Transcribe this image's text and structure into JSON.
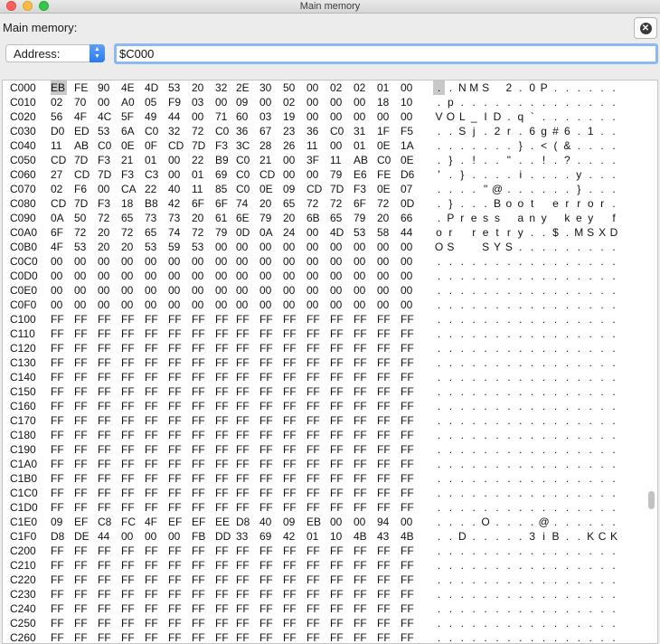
{
  "window": {
    "title": "Main memory"
  },
  "panel": {
    "label": "Main memory:"
  },
  "address_select": {
    "selected": "Address:"
  },
  "address_input": {
    "value": "$C000"
  },
  "colors": {
    "selection": "#c8c8c8",
    "focus_ring": "#8eb8f0",
    "popup_button": "#2a79f2"
  },
  "highlight": {
    "row": 0,
    "byte": 0
  },
  "rows": [
    {
      "addr": "C000",
      "bytes": [
        "EB",
        "FE",
        "90",
        "4E",
        "4D",
        "53",
        "20",
        "32",
        "2E",
        "30",
        "50",
        "00",
        "02",
        "02",
        "01",
        "00"
      ],
      "ascii": "..NMS 2.0P......"
    },
    {
      "addr": "C010",
      "bytes": [
        "02",
        "70",
        "00",
        "A0",
        "05",
        "F9",
        "03",
        "00",
        "09",
        "00",
        "02",
        "00",
        "00",
        "00",
        "18",
        "10"
      ],
      "ascii": ".p.............."
    },
    {
      "addr": "C020",
      "bytes": [
        "56",
        "4F",
        "4C",
        "5F",
        "49",
        "44",
        "00",
        "71",
        "60",
        "03",
        "19",
        "00",
        "00",
        "00",
        "00",
        "00"
      ],
      "ascii": "VOL_ID.q`......."
    },
    {
      "addr": "C030",
      "bytes": [
        "D0",
        "ED",
        "53",
        "6A",
        "C0",
        "32",
        "72",
        "C0",
        "36",
        "67",
        "23",
        "36",
        "C0",
        "31",
        "1F",
        "F5"
      ],
      "ascii": "..Sj.2r.6g#6.1.."
    },
    {
      "addr": "C040",
      "bytes": [
        "11",
        "AB",
        "C0",
        "0E",
        "0F",
        "CD",
        "7D",
        "F3",
        "3C",
        "28",
        "26",
        "11",
        "00",
        "01",
        "0E",
        "1A"
      ],
      "ascii": ".......}.<(&...."
    },
    {
      "addr": "C050",
      "bytes": [
        "CD",
        "7D",
        "F3",
        "21",
        "01",
        "00",
        "22",
        "B9",
        "C0",
        "21",
        "00",
        "3F",
        "11",
        "AB",
        "C0",
        "0E"
      ],
      "ascii": ".}.!..\"..!.?...."
    },
    {
      "addr": "C060",
      "bytes": [
        "27",
        "CD",
        "7D",
        "F3",
        "C3",
        "00",
        "01",
        "69",
        "C0",
        "CD",
        "00",
        "00",
        "79",
        "E6",
        "FE",
        "D6"
      ],
      "ascii": "'.}....i....y..."
    },
    {
      "addr": "C070",
      "bytes": [
        "02",
        "F6",
        "00",
        "CA",
        "22",
        "40",
        "11",
        "85",
        "C0",
        "0E",
        "09",
        "CD",
        "7D",
        "F3",
        "0E",
        "07"
      ],
      "ascii": "....\"@......}..."
    },
    {
      "addr": "C080",
      "bytes": [
        "CD",
        "7D",
        "F3",
        "18",
        "B8",
        "42",
        "6F",
        "6F",
        "74",
        "20",
        "65",
        "72",
        "72",
        "6F",
        "72",
        "0D"
      ],
      "ascii": ".}...Boot error."
    },
    {
      "addr": "C090",
      "bytes": [
        "0A",
        "50",
        "72",
        "65",
        "73",
        "73",
        "20",
        "61",
        "6E",
        "79",
        "20",
        "6B",
        "65",
        "79",
        "20",
        "66"
      ],
      "ascii": ".Press any key f"
    },
    {
      "addr": "C0A0",
      "bytes": [
        "6F",
        "72",
        "20",
        "72",
        "65",
        "74",
        "72",
        "79",
        "0D",
        "0A",
        "24",
        "00",
        "4D",
        "53",
        "58",
        "44"
      ],
      "ascii": "or retry..$.MSXD"
    },
    {
      "addr": "C0B0",
      "bytes": [
        "4F",
        "53",
        "20",
        "20",
        "53",
        "59",
        "53",
        "00",
        "00",
        "00",
        "00",
        "00",
        "00",
        "00",
        "00",
        "00"
      ],
      "ascii": "OS  SYS........."
    },
    {
      "addr": "C0C0",
      "bytes": [
        "00",
        "00",
        "00",
        "00",
        "00",
        "00",
        "00",
        "00",
        "00",
        "00",
        "00",
        "00",
        "00",
        "00",
        "00",
        "00"
      ],
      "ascii": "................"
    },
    {
      "addr": "C0D0",
      "bytes": [
        "00",
        "00",
        "00",
        "00",
        "00",
        "00",
        "00",
        "00",
        "00",
        "00",
        "00",
        "00",
        "00",
        "00",
        "00",
        "00"
      ],
      "ascii": "................"
    },
    {
      "addr": "C0E0",
      "bytes": [
        "00",
        "00",
        "00",
        "00",
        "00",
        "00",
        "00",
        "00",
        "00",
        "00",
        "00",
        "00",
        "00",
        "00",
        "00",
        "00"
      ],
      "ascii": "................"
    },
    {
      "addr": "C0F0",
      "bytes": [
        "00",
        "00",
        "00",
        "00",
        "00",
        "00",
        "00",
        "00",
        "00",
        "00",
        "00",
        "00",
        "00",
        "00",
        "00",
        "00"
      ],
      "ascii": "................"
    },
    {
      "addr": "C100",
      "bytes": [
        "FF",
        "FF",
        "FF",
        "FF",
        "FF",
        "FF",
        "FF",
        "FF",
        "FF",
        "FF",
        "FF",
        "FF",
        "FF",
        "FF",
        "FF",
        "FF"
      ],
      "ascii": "................"
    },
    {
      "addr": "C110",
      "bytes": [
        "FF",
        "FF",
        "FF",
        "FF",
        "FF",
        "FF",
        "FF",
        "FF",
        "FF",
        "FF",
        "FF",
        "FF",
        "FF",
        "FF",
        "FF",
        "FF"
      ],
      "ascii": "................"
    },
    {
      "addr": "C120",
      "bytes": [
        "FF",
        "FF",
        "FF",
        "FF",
        "FF",
        "FF",
        "FF",
        "FF",
        "FF",
        "FF",
        "FF",
        "FF",
        "FF",
        "FF",
        "FF",
        "FF"
      ],
      "ascii": "................"
    },
    {
      "addr": "C130",
      "bytes": [
        "FF",
        "FF",
        "FF",
        "FF",
        "FF",
        "FF",
        "FF",
        "FF",
        "FF",
        "FF",
        "FF",
        "FF",
        "FF",
        "FF",
        "FF",
        "FF"
      ],
      "ascii": "................"
    },
    {
      "addr": "C140",
      "bytes": [
        "FF",
        "FF",
        "FF",
        "FF",
        "FF",
        "FF",
        "FF",
        "FF",
        "FF",
        "FF",
        "FF",
        "FF",
        "FF",
        "FF",
        "FF",
        "FF"
      ],
      "ascii": "................"
    },
    {
      "addr": "C150",
      "bytes": [
        "FF",
        "FF",
        "FF",
        "FF",
        "FF",
        "FF",
        "FF",
        "FF",
        "FF",
        "FF",
        "FF",
        "FF",
        "FF",
        "FF",
        "FF",
        "FF"
      ],
      "ascii": "................"
    },
    {
      "addr": "C160",
      "bytes": [
        "FF",
        "FF",
        "FF",
        "FF",
        "FF",
        "FF",
        "FF",
        "FF",
        "FF",
        "FF",
        "FF",
        "FF",
        "FF",
        "FF",
        "FF",
        "FF"
      ],
      "ascii": "................"
    },
    {
      "addr": "C170",
      "bytes": [
        "FF",
        "FF",
        "FF",
        "FF",
        "FF",
        "FF",
        "FF",
        "FF",
        "FF",
        "FF",
        "FF",
        "FF",
        "FF",
        "FF",
        "FF",
        "FF"
      ],
      "ascii": "................"
    },
    {
      "addr": "C180",
      "bytes": [
        "FF",
        "FF",
        "FF",
        "FF",
        "FF",
        "FF",
        "FF",
        "FF",
        "FF",
        "FF",
        "FF",
        "FF",
        "FF",
        "FF",
        "FF",
        "FF"
      ],
      "ascii": "................"
    },
    {
      "addr": "C190",
      "bytes": [
        "FF",
        "FF",
        "FF",
        "FF",
        "FF",
        "FF",
        "FF",
        "FF",
        "FF",
        "FF",
        "FF",
        "FF",
        "FF",
        "FF",
        "FF",
        "FF"
      ],
      "ascii": "................"
    },
    {
      "addr": "C1A0",
      "bytes": [
        "FF",
        "FF",
        "FF",
        "FF",
        "FF",
        "FF",
        "FF",
        "FF",
        "FF",
        "FF",
        "FF",
        "FF",
        "FF",
        "FF",
        "FF",
        "FF"
      ],
      "ascii": "................"
    },
    {
      "addr": "C1B0",
      "bytes": [
        "FF",
        "FF",
        "FF",
        "FF",
        "FF",
        "FF",
        "FF",
        "FF",
        "FF",
        "FF",
        "FF",
        "FF",
        "FF",
        "FF",
        "FF",
        "FF"
      ],
      "ascii": "................"
    },
    {
      "addr": "C1C0",
      "bytes": [
        "FF",
        "FF",
        "FF",
        "FF",
        "FF",
        "FF",
        "FF",
        "FF",
        "FF",
        "FF",
        "FF",
        "FF",
        "FF",
        "FF",
        "FF",
        "FF"
      ],
      "ascii": "................"
    },
    {
      "addr": "C1D0",
      "bytes": [
        "FF",
        "FF",
        "FF",
        "FF",
        "FF",
        "FF",
        "FF",
        "FF",
        "FF",
        "FF",
        "FF",
        "FF",
        "FF",
        "FF",
        "FF",
        "FF"
      ],
      "ascii": "................"
    },
    {
      "addr": "C1E0",
      "bytes": [
        "09",
        "EF",
        "C8",
        "FC",
        "4F",
        "EF",
        "EF",
        "EE",
        "D8",
        "40",
        "09",
        "EB",
        "00",
        "00",
        "94",
        "00"
      ],
      "ascii": "....O....@......"
    },
    {
      "addr": "C1F0",
      "bytes": [
        "D8",
        "DE",
        "44",
        "00",
        "00",
        "00",
        "FB",
        "DD",
        "33",
        "69",
        "42",
        "01",
        "10",
        "4B",
        "43",
        "4B"
      ],
      "ascii": "..D.....3iB..KCK"
    },
    {
      "addr": "C200",
      "bytes": [
        "FF",
        "FF",
        "FF",
        "FF",
        "FF",
        "FF",
        "FF",
        "FF",
        "FF",
        "FF",
        "FF",
        "FF",
        "FF",
        "FF",
        "FF",
        "FF"
      ],
      "ascii": "................"
    },
    {
      "addr": "C210",
      "bytes": [
        "FF",
        "FF",
        "FF",
        "FF",
        "FF",
        "FF",
        "FF",
        "FF",
        "FF",
        "FF",
        "FF",
        "FF",
        "FF",
        "FF",
        "FF",
        "FF"
      ],
      "ascii": "................"
    },
    {
      "addr": "C220",
      "bytes": [
        "FF",
        "FF",
        "FF",
        "FF",
        "FF",
        "FF",
        "FF",
        "FF",
        "FF",
        "FF",
        "FF",
        "FF",
        "FF",
        "FF",
        "FF",
        "FF"
      ],
      "ascii": "................"
    },
    {
      "addr": "C230",
      "bytes": [
        "FF",
        "FF",
        "FF",
        "FF",
        "FF",
        "FF",
        "FF",
        "FF",
        "FF",
        "FF",
        "FF",
        "FF",
        "FF",
        "FF",
        "FF",
        "FF"
      ],
      "ascii": "................"
    },
    {
      "addr": "C240",
      "bytes": [
        "FF",
        "FF",
        "FF",
        "FF",
        "FF",
        "FF",
        "FF",
        "FF",
        "FF",
        "FF",
        "FF",
        "FF",
        "FF",
        "FF",
        "FF",
        "FF"
      ],
      "ascii": "................"
    },
    {
      "addr": "C250",
      "bytes": [
        "FF",
        "FF",
        "FF",
        "FF",
        "FF",
        "FF",
        "FF",
        "FF",
        "FF",
        "FF",
        "FF",
        "FF",
        "FF",
        "FF",
        "FF",
        "FF"
      ],
      "ascii": "................"
    },
    {
      "addr": "C260",
      "bytes": [
        "FF",
        "FF",
        "FF",
        "FF",
        "FF",
        "FF",
        "FF",
        "FF",
        "FF",
        "FF",
        "FF",
        "FF",
        "FF",
        "FF",
        "FF",
        "FF"
      ],
      "ascii": "................"
    }
  ]
}
